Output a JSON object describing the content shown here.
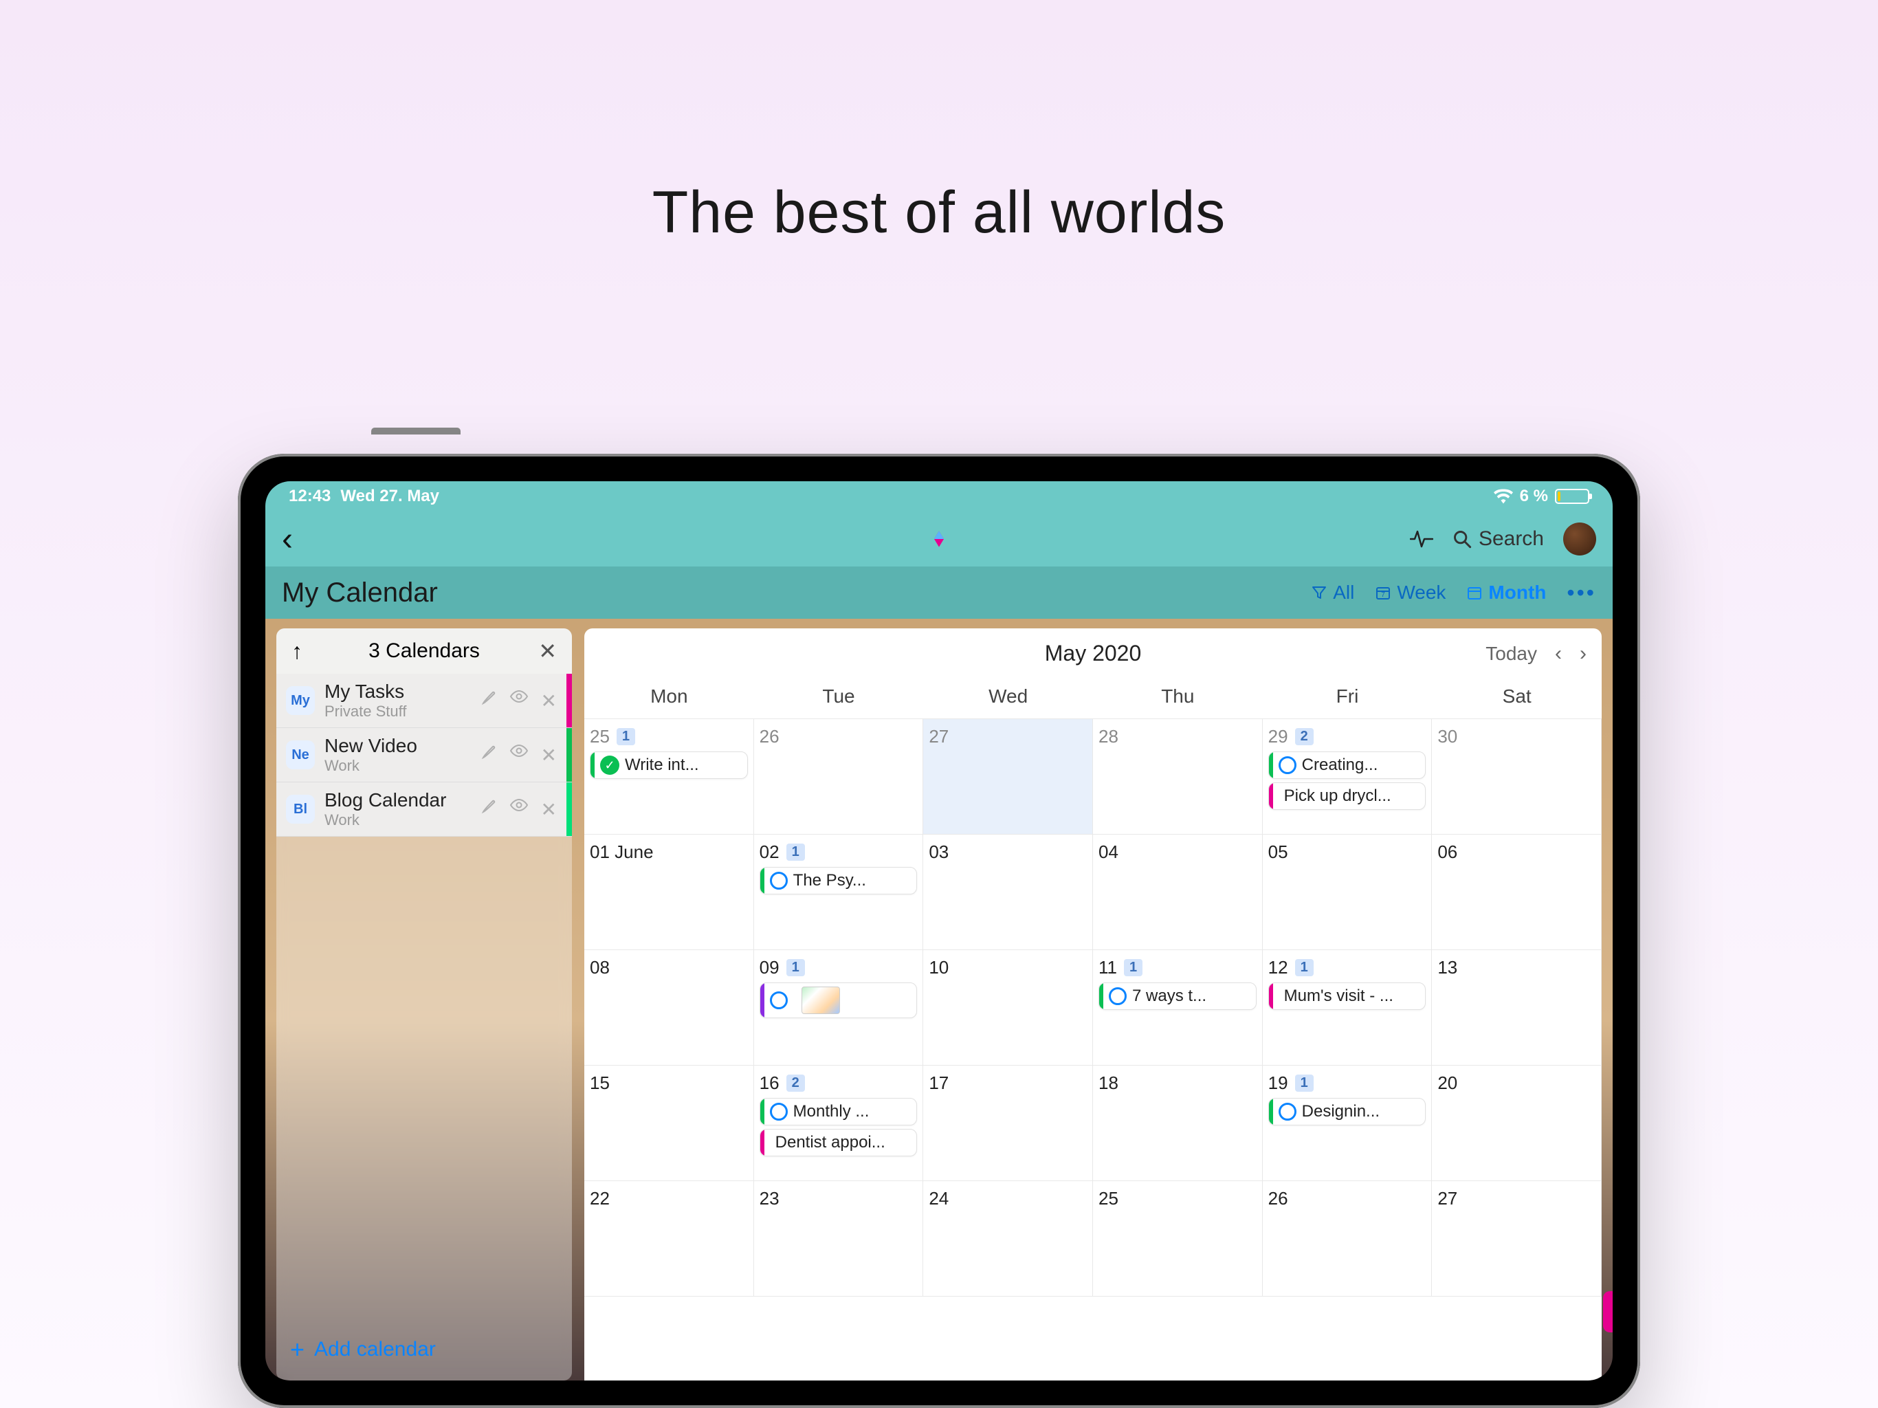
{
  "headline": "The best of all worlds",
  "status": {
    "time": "12:43",
    "date": "Wed 27. May",
    "battery_pct": "6 %"
  },
  "nav": {
    "search_label": "Search"
  },
  "header": {
    "title": "My Calendar"
  },
  "views": {
    "filter": "All",
    "week": "Week",
    "month": "Month",
    "active": "month"
  },
  "sidebar": {
    "title": "3 Calendars",
    "items": [
      {
        "badge": "My",
        "name": "My Tasks",
        "sub": "Private Stuff",
        "color": "#e6008f"
      },
      {
        "badge": "Ne",
        "name": "New Video",
        "sub": "Work",
        "color": "#0abf53"
      },
      {
        "badge": "Bl",
        "name": "Blog Calendar",
        "sub": "Work",
        "color": "#00e07a"
      }
    ],
    "add_label": "Add calendar"
  },
  "calendar": {
    "month_title": "May 2020",
    "today_label": "Today",
    "weekdays": [
      "Mon",
      "Tue",
      "Wed",
      "Thu",
      "Fri",
      "Sat"
    ],
    "rows": [
      [
        {
          "num": "25",
          "muted": true,
          "badge": "1",
          "events": [
            {
              "type": "check",
              "bar": "#0abf53",
              "text": "Write int..."
            }
          ]
        },
        {
          "num": "26",
          "muted": true
        },
        {
          "num": "27",
          "muted": true,
          "today": true
        },
        {
          "num": "28",
          "muted": true
        },
        {
          "num": "29",
          "muted": true,
          "badge": "2",
          "events": [
            {
              "type": "circle",
              "bar": "#0abf53",
              "text": "Creating..."
            },
            {
              "type": "none",
              "bar": "#e6008f",
              "text": "Pick up drycl..."
            }
          ]
        },
        {
          "num": "30",
          "muted": true
        }
      ],
      [
        {
          "num": "01 June"
        },
        {
          "num": "02",
          "badge": "1",
          "events": [
            {
              "type": "circle",
              "bar": "#0abf53",
              "text": "The Psy..."
            }
          ]
        },
        {
          "num": "03"
        },
        {
          "num": "04"
        },
        {
          "num": "05"
        },
        {
          "num": "06"
        }
      ],
      [
        {
          "num": "08"
        },
        {
          "num": "09",
          "badge": "1",
          "events": [
            {
              "type": "circle",
              "bar": "#8a2be2",
              "text": "",
              "thumb": true
            }
          ]
        },
        {
          "num": "10"
        },
        {
          "num": "11",
          "badge": "1",
          "events": [
            {
              "type": "circle",
              "bar": "#0abf53",
              "text": "7 ways t..."
            }
          ]
        },
        {
          "num": "12",
          "badge": "1",
          "events": [
            {
              "type": "none",
              "bar": "#e6008f",
              "text": "Mum's visit - ..."
            }
          ]
        },
        {
          "num": "13"
        }
      ],
      [
        {
          "num": "15"
        },
        {
          "num": "16",
          "badge": "2",
          "events": [
            {
              "type": "circle",
              "bar": "#0abf53",
              "text": "Monthly ..."
            },
            {
              "type": "none",
              "bar": "#e6008f",
              "text": "Dentist appoi..."
            }
          ]
        },
        {
          "num": "17"
        },
        {
          "num": "18"
        },
        {
          "num": "19",
          "badge": "1",
          "events": [
            {
              "type": "circle",
              "bar": "#0abf53",
              "text": "Designin..."
            }
          ]
        },
        {
          "num": "20"
        }
      ],
      [
        {
          "num": "22"
        },
        {
          "num": "23"
        },
        {
          "num": "24"
        },
        {
          "num": "25"
        },
        {
          "num": "26"
        },
        {
          "num": "27"
        }
      ]
    ]
  }
}
